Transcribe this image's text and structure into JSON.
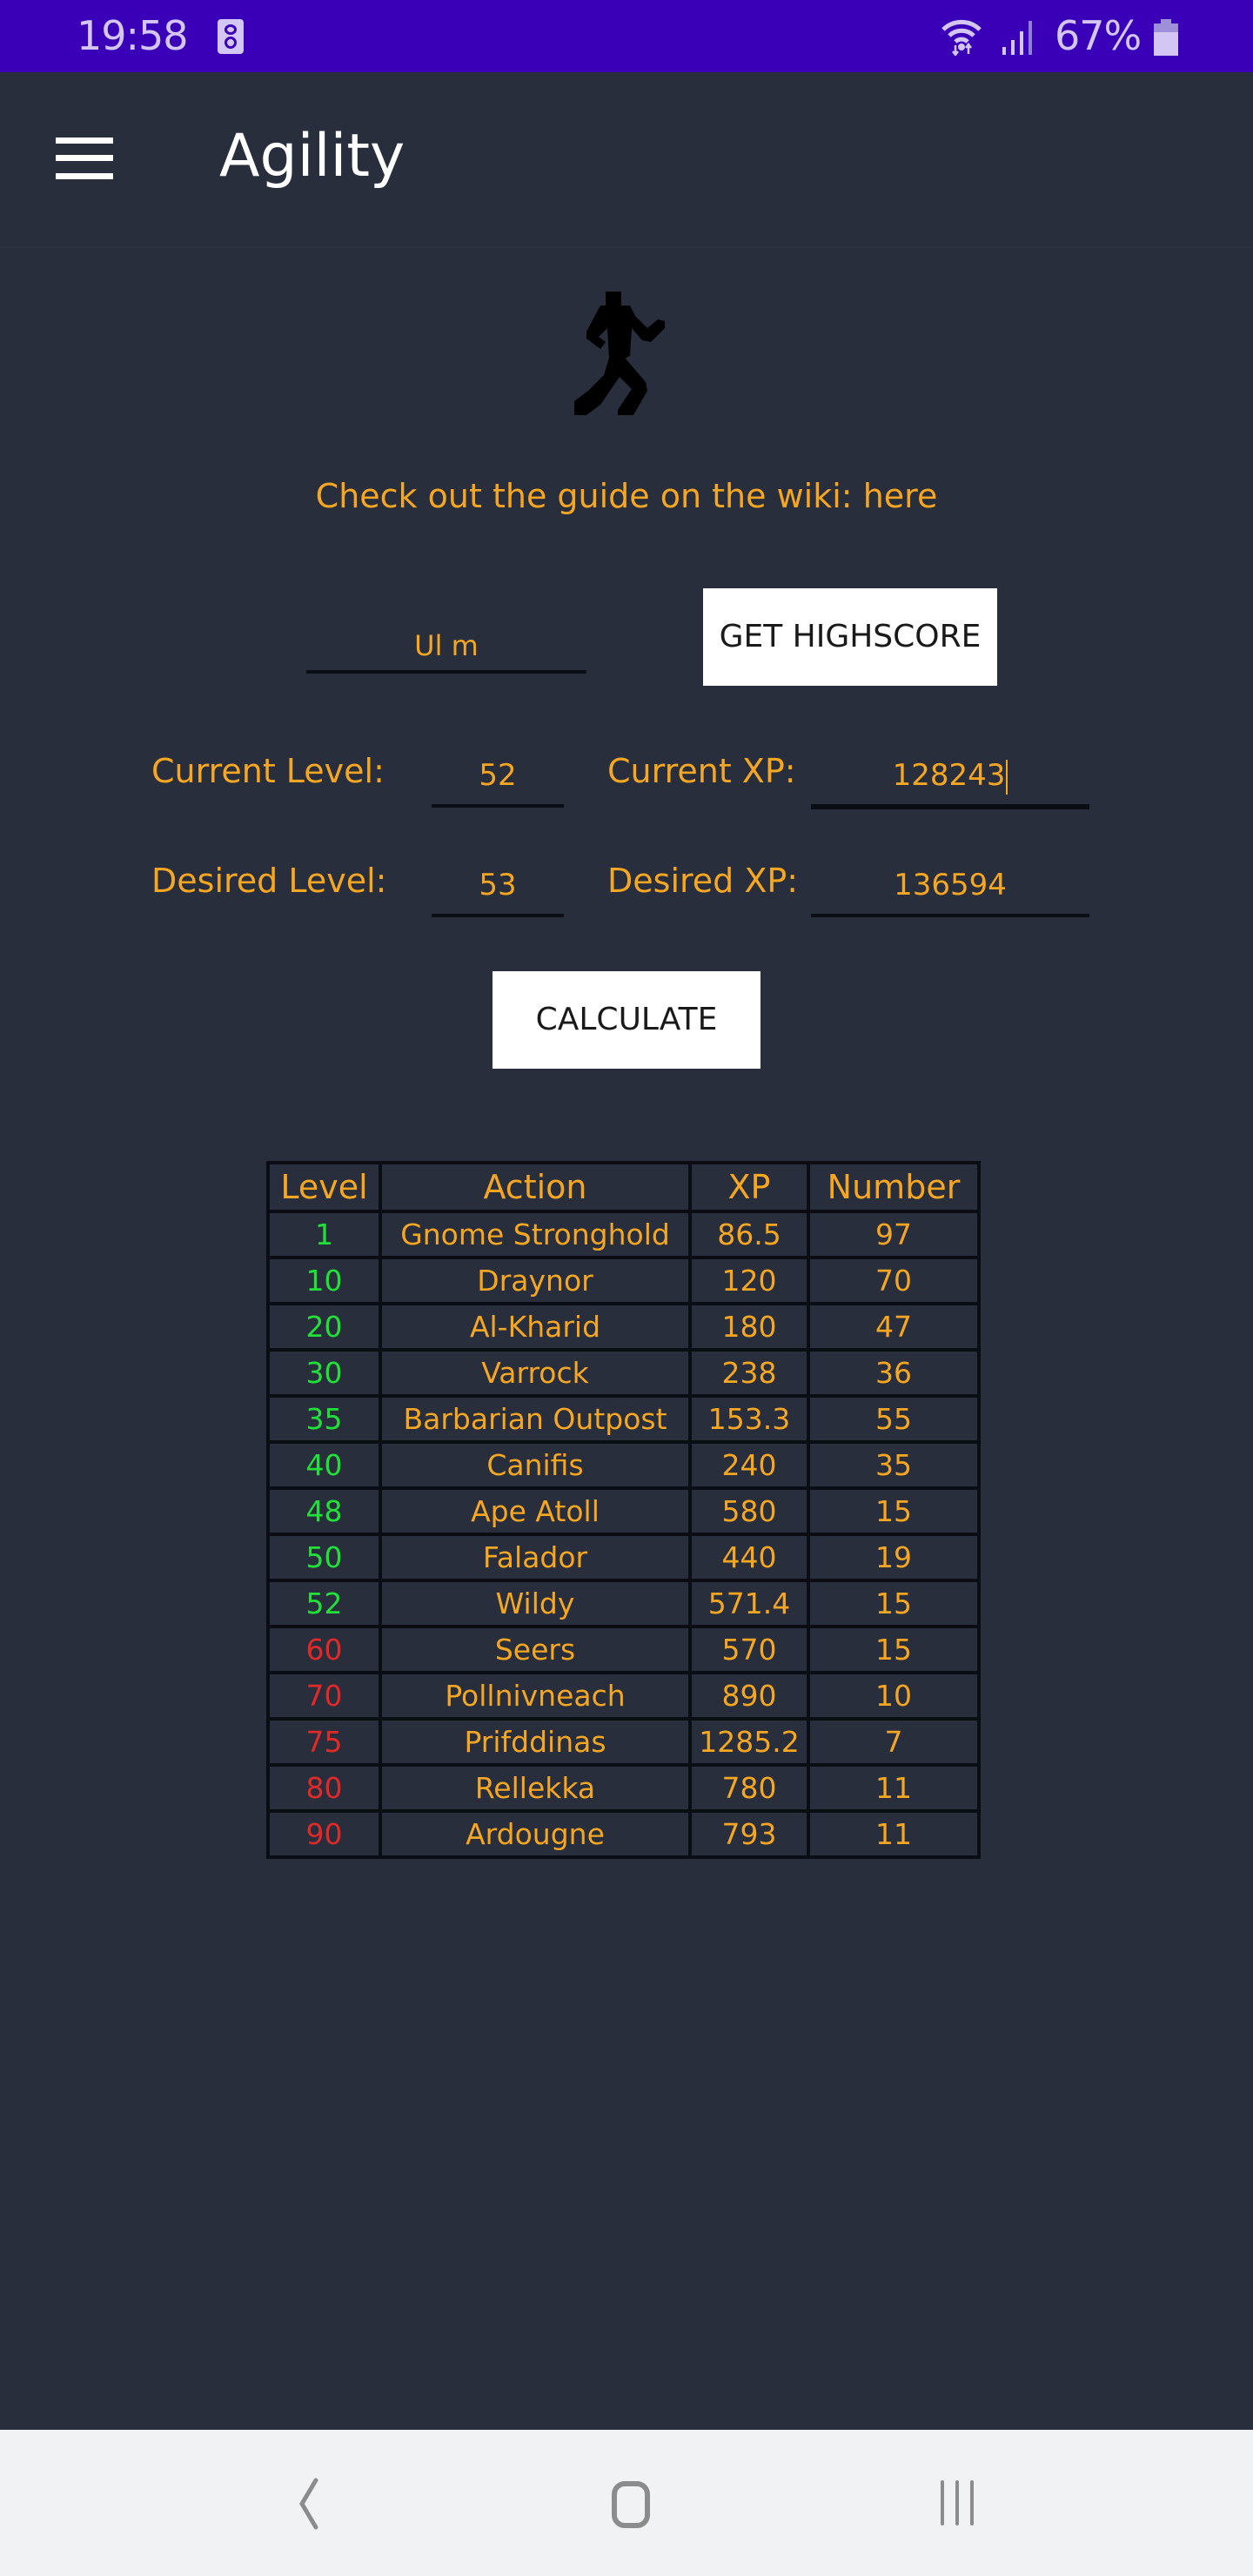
{
  "status_bar": {
    "time": "19:58",
    "battery_percent": "67%",
    "icons": [
      "media-icon",
      "wifi-icon",
      "signal-icon",
      "battery-icon"
    ],
    "color": "#3a00b8"
  },
  "app_bar": {
    "title": "Agility",
    "menu_icon": "hamburger-icon"
  },
  "skill_icon": "runner-icon",
  "wiki": {
    "prefix": "Check out the guide on the wiki: ",
    "link_label": "here"
  },
  "form": {
    "username_value": "Ul m",
    "get_highscore_label": "GET HIGHSCORE",
    "current_level_label": "Current Level:",
    "current_level_value": "52",
    "current_xp_label": "Current XP:",
    "current_xp_value": "128243",
    "desired_level_label": "Desired Level:",
    "desired_level_value": "53",
    "desired_xp_label": "Desired XP:",
    "desired_xp_value": "136594",
    "calculate_label": "CALCULATE"
  },
  "table": {
    "headers": [
      "Level",
      "Action",
      "XP",
      "Number"
    ],
    "rows": [
      {
        "level": "1",
        "action": "Gnome Stronghold",
        "xp": "86.5",
        "number": "97",
        "status": "green"
      },
      {
        "level": "10",
        "action": "Draynor",
        "xp": "120",
        "number": "70",
        "status": "green"
      },
      {
        "level": "20",
        "action": "Al-Kharid",
        "xp": "180",
        "number": "47",
        "status": "green"
      },
      {
        "level": "30",
        "action": "Varrock",
        "xp": "238",
        "number": "36",
        "status": "green"
      },
      {
        "level": "35",
        "action": "Barbarian Outpost",
        "xp": "153.3",
        "number": "55",
        "status": "green"
      },
      {
        "level": "40",
        "action": "Canifis",
        "xp": "240",
        "number": "35",
        "status": "green"
      },
      {
        "level": "48",
        "action": "Ape Atoll",
        "xp": "580",
        "number": "15",
        "status": "green"
      },
      {
        "level": "50",
        "action": "Falador",
        "xp": "440",
        "number": "19",
        "status": "green"
      },
      {
        "level": "52",
        "action": "Wildy",
        "xp": "571.4",
        "number": "15",
        "status": "green"
      },
      {
        "level": "60",
        "action": "Seers",
        "xp": "570",
        "number": "15",
        "status": "red"
      },
      {
        "level": "70",
        "action": "Pollnivneach",
        "xp": "890",
        "number": "10",
        "status": "red"
      },
      {
        "level": "75",
        "action": "Prifddinas",
        "xp": "1285.2",
        "number": "7",
        "status": "red"
      },
      {
        "level": "80",
        "action": "Rellekka",
        "xp": "780",
        "number": "11",
        "status": "red"
      },
      {
        "level": "90",
        "action": "Ardougne",
        "xp": "793",
        "number": "11",
        "status": "red"
      }
    ]
  },
  "colors": {
    "accent": "#f5a623",
    "unlocked": "#22e03a",
    "locked": "#e02a2a",
    "background": "#282e3b"
  },
  "nav_bar": {
    "icons": [
      "back-icon",
      "home-icon",
      "recents-icon"
    ]
  }
}
